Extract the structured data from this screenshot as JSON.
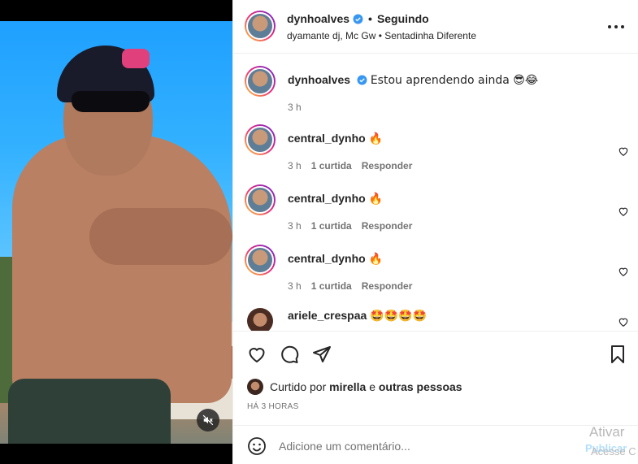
{
  "post": {
    "author": "dynhoalves",
    "follow_status": "Seguindo",
    "audio": "dyamante dj, Mc Gw • Sentadinha Diferente",
    "caption": "Estou aprendendo ainda 😎😂",
    "caption_time": "3 h"
  },
  "comments": [
    {
      "user": "central_dynho",
      "text": "🔥",
      "time": "3 h",
      "likes": "1 curtida",
      "reply": "Responder"
    },
    {
      "user": "central_dynho",
      "text": "🔥",
      "time": "3 h",
      "likes": "1 curtida",
      "reply": "Responder"
    },
    {
      "user": "central_dynho",
      "text": "🔥",
      "time": "3 h",
      "likes": "1 curtida",
      "reply": "Responder"
    },
    {
      "user": "ariele_crespaa",
      "text": "🤩🤩🤩🤩"
    }
  ],
  "likes": {
    "prefix": "Curtido por",
    "user": "mirella",
    "conjunction": "e",
    "others": "outras pessoas"
  },
  "timestamp": "HÁ 3 HORAS",
  "add_comment": {
    "placeholder": "Adicione um comentário...",
    "publish": "Publicar"
  },
  "watermark": {
    "line1": "Ativar",
    "line2": "Acesse C"
  },
  "icons": {
    "verified": "verified-badge-icon",
    "more": "more-options-icon",
    "heart": "heart-icon",
    "comment": "comment-icon",
    "share": "share-icon",
    "save": "bookmark-icon",
    "emoji": "emoji-icon",
    "mute": "muted-speaker-icon"
  },
  "colors": {
    "verified": "#3897f0",
    "secondary_text": "#737373",
    "publish_disabled": "#b2dffc"
  }
}
